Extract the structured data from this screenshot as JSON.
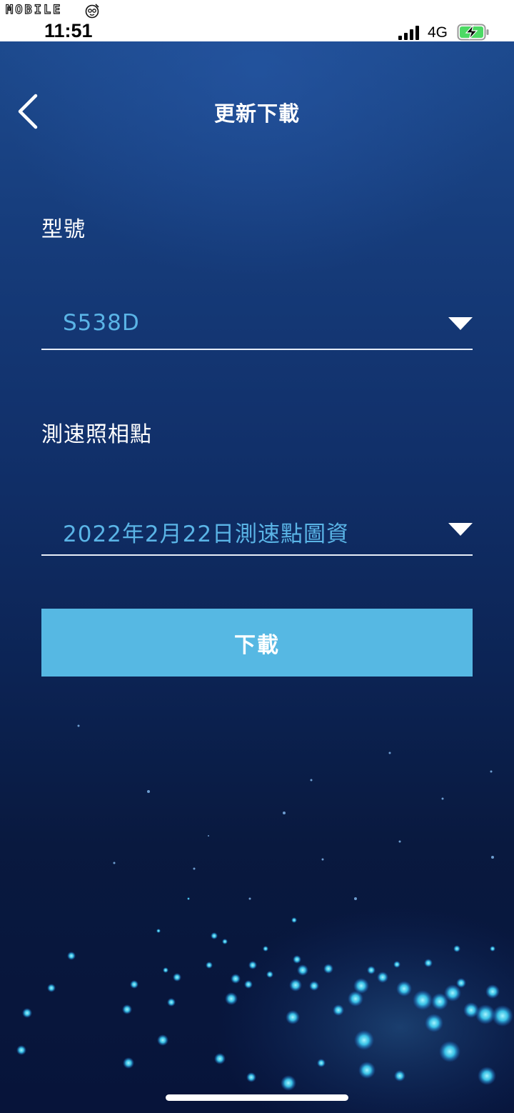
{
  "status_bar": {
    "watermark": "MOBILE",
    "time": "11:51",
    "network": "4G",
    "icons": [
      "signal-icon",
      "battery-charging-icon"
    ]
  },
  "header": {
    "back_icon": "chevron-left-icon",
    "title": "更新下載"
  },
  "form": {
    "model": {
      "label": "型號",
      "selected": "S538D",
      "icon": "chevron-down-icon"
    },
    "speed_camera": {
      "label": "測速照相點",
      "selected": "2022年2月22日測速點圖資",
      "icon": "chevron-down-icon"
    },
    "download_label": "下載"
  },
  "colors": {
    "accent": "#56b8e3",
    "value_text": "#5ab4e6",
    "background_top": "#1d4a8e",
    "background_bottom": "#07143a",
    "battery_fill": "#4cd964"
  }
}
